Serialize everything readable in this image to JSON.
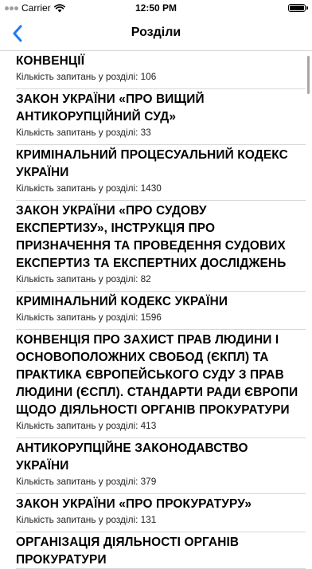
{
  "status_bar": {
    "carrier": "Carrier",
    "time": "12:50 PM",
    "wifi_icon": "wifi-icon",
    "battery_icon": "battery-icon",
    "battery_level": 1.0
  },
  "nav": {
    "title": "Розділи",
    "back_icon": "chevron-left-icon",
    "accent_color": "#1f7af6"
  },
  "count_prefix": "Кількість запитань у розділі:",
  "sections": [
    {
      "title": "КОНВЕНЦІЇ",
      "count": "Кількість запитань у розділі: 106"
    },
    {
      "title": "ЗАКОН УКРАЇНИ «ПРО ВИЩИЙ АНТИКОРУПЦІЙНИЙ СУД»",
      "count": "Кількість запитань у розділі: 33"
    },
    {
      "title": "КРИМІНАЛЬНИЙ ПРОЦЕСУАЛЬНИЙ КОДЕКС УКРАЇНИ",
      "count": "Кількість запитань у розділі: 1430"
    },
    {
      "title": "ЗАКОН УКРАЇНИ «ПРО СУДОВУ ЕКСПЕРТИЗУ», ІНСТРУКЦІЯ ПРО ПРИЗНАЧЕННЯ ТА ПРОВЕДЕННЯ СУДОВИХ ЕКСПЕРТИЗ ТА ЕКСПЕРТНИХ ДОСЛІДЖЕНЬ",
      "count": "Кількість запитань у розділі: 82"
    },
    {
      "title": "КРИМІНАЛЬНИЙ КОДЕКС УКРАЇНИ",
      "count": "Кількість запитань у розділі: 1596"
    },
    {
      "title": "КОНВЕНЦІЯ ПРО ЗАХИСТ ПРАВ ЛЮДИНИ І ОСНОВОПОЛОЖНИХ СВОБОД (ЄКПЛ) ТА ПРАКТИКА ЄВРОПЕЙСЬКОГО СУДУ З ПРАВ ЛЮДИНИ (ЄСПЛ). СТАНДАРТИ РАДИ ЄВРОПИ ЩОДО ДІЯЛЬНОСТІ ОРГАНІВ ПРОКУРАТУРИ",
      "count": "Кількість запитань у розділі: 413"
    },
    {
      "title": "АНТИКОРУПЦІЙНЕ ЗАКОНОДАВСТВО УКРАЇНИ",
      "count": "Кількість запитань у розділі: 379"
    },
    {
      "title": "ЗАКОН УКРАЇНИ «ПРО ПРОКУРАТУРУ»",
      "count": "Кількість запитань у розділі: 131"
    },
    {
      "title": "ОРГАНІЗАЦІЯ ДІЯЛЬНОСТІ ОРГАНІВ ПРОКУРАТУРИ",
      "count": ""
    }
  ]
}
